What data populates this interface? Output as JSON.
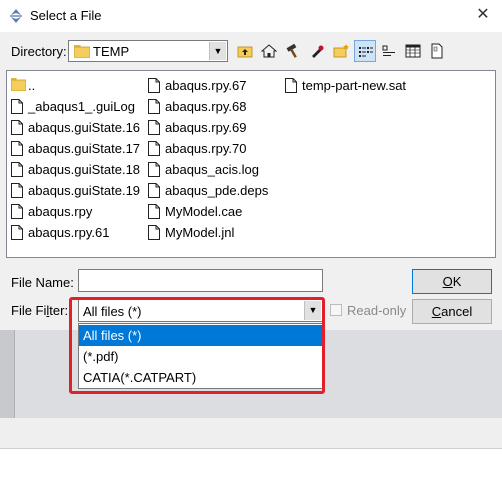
{
  "window": {
    "title": "Select a File",
    "close_glyph": "✕"
  },
  "directory": {
    "label": "Directory:",
    "value": "TEMP"
  },
  "toolbar": {
    "buttons": [
      {
        "name": "up-folder-icon"
      },
      {
        "name": "home-icon"
      },
      {
        "name": "work-dir-icon"
      },
      {
        "name": "bookmark-icon"
      },
      {
        "name": "new-folder-icon"
      },
      {
        "name": "list-view-icon"
      },
      {
        "name": "icon-view-icon"
      },
      {
        "name": "detail-view-icon"
      },
      {
        "name": "file-properties-icon"
      }
    ]
  },
  "files": {
    "col1": [
      "..",
      "_abaqus1_.guiLog",
      "abaqus.guiState.16",
      "abaqus.guiState.17",
      "abaqus.guiState.18",
      "abaqus.guiState.19",
      "abaqus.rpy",
      "abaqus.rpy.61"
    ],
    "col2": [
      "abaqus.rpy.67",
      "abaqus.rpy.68",
      "abaqus.rpy.69",
      "abaqus.rpy.70",
      "abaqus_acis.log",
      "abaqus_pde.deps",
      "MyModel.cae",
      "MyModel.jnl"
    ],
    "col3": [
      "temp-part-new.sat"
    ]
  },
  "file_name": {
    "label_pre": "File Name:",
    "value": ""
  },
  "file_filter": {
    "label_pre": "File Fi",
    "label_ul": "l",
    "label_post": "ter:",
    "value": "All files (*)",
    "options": [
      "All files (*)",
      "(*.pdf)",
      "CATIA(*.CATPART)"
    ]
  },
  "buttons": {
    "ok_ul": "O",
    "ok_post": "K",
    "cancel_ul": "C",
    "cancel_post": "ancel"
  },
  "read_only": {
    "label": "Read-only",
    "checked": false
  },
  "colors": {
    "accent": "#0078d7",
    "highlight": "#e0202a"
  }
}
